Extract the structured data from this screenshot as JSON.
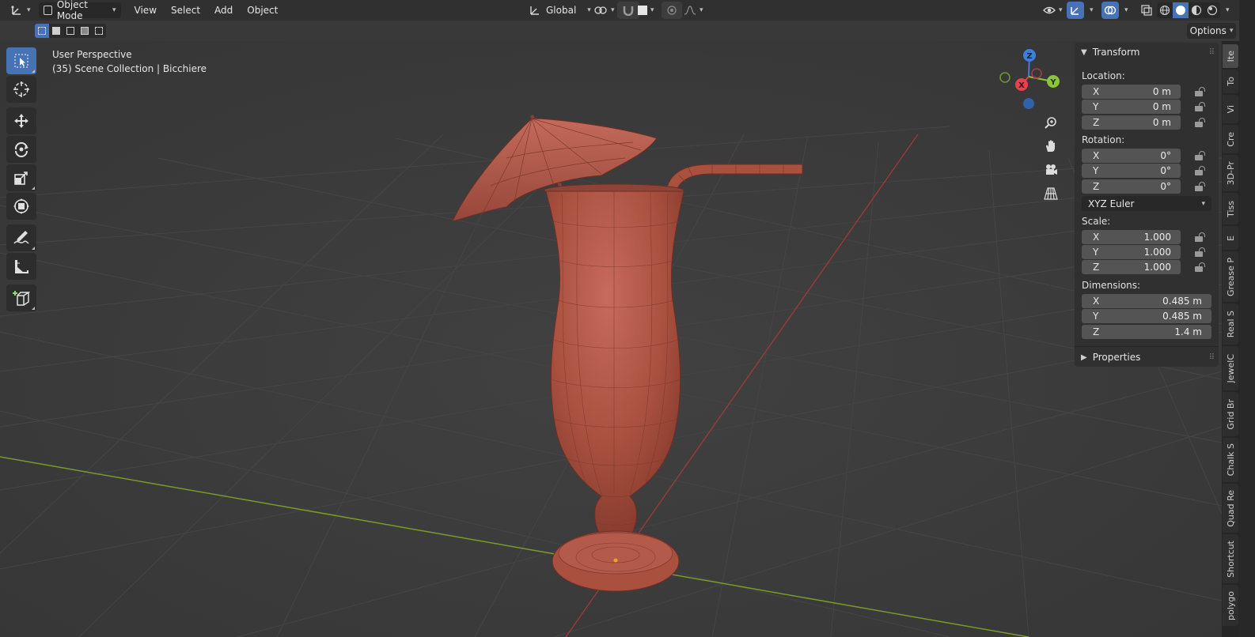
{
  "header": {
    "editor_type_icon": "axes-editor-icon",
    "mode": "Object Mode",
    "menus": [
      "View",
      "Select",
      "Add",
      "Object"
    ],
    "transform_orientation": "Global",
    "options_label": "Options"
  },
  "viewport": {
    "perspective": "User Perspective",
    "collection_info": "(35) Scene Collection | Bicchiere",
    "gizmo_axes": {
      "z": "Z",
      "y": "Y",
      "x": "X"
    }
  },
  "toolbar": {
    "tools": [
      "select-box-icon",
      "cursor-icon",
      "move-icon",
      "rotate-icon",
      "scale-icon",
      "transform-icon",
      "annotate-icon",
      "measure-icon",
      "add-cube-icon"
    ]
  },
  "npanel": {
    "transform_title": "Transform",
    "location_label": "Location:",
    "location": [
      {
        "axis": "X",
        "value": "0 m"
      },
      {
        "axis": "Y",
        "value": "0 m"
      },
      {
        "axis": "Z",
        "value": "0 m"
      }
    ],
    "rotation_label": "Rotation:",
    "rotation": [
      {
        "axis": "X",
        "value": "0°"
      },
      {
        "axis": "Y",
        "value": "0°"
      },
      {
        "axis": "Z",
        "value": "0°"
      }
    ],
    "rotation_mode": "XYZ Euler",
    "scale_label": "Scale:",
    "scale": [
      {
        "axis": "X",
        "value": "1.000"
      },
      {
        "axis": "Y",
        "value": "1.000"
      },
      {
        "axis": "Z",
        "value": "1.000"
      }
    ],
    "dimensions_label": "Dimensions:",
    "dimensions": [
      {
        "axis": "X",
        "value": "0.485 m"
      },
      {
        "axis": "Y",
        "value": "0.485 m"
      },
      {
        "axis": "Z",
        "value": "1.4 m"
      }
    ],
    "properties_title": "Properties"
  },
  "sidetabs": [
    "Ite",
    "To",
    "Vi",
    "Cre",
    "3D-Pr",
    "Tiss",
    "E",
    "Grease P",
    "Real S",
    "JewelC",
    "Grid Br",
    "Chalk S",
    "Quad Re",
    "Shortcut",
    "polygo"
  ],
  "colors": {
    "accent": "#4772b3",
    "model": "#b5594a",
    "x_axis": "#e8404f",
    "y_axis": "#8cc43a",
    "z_axis": "#3d7fd9"
  }
}
